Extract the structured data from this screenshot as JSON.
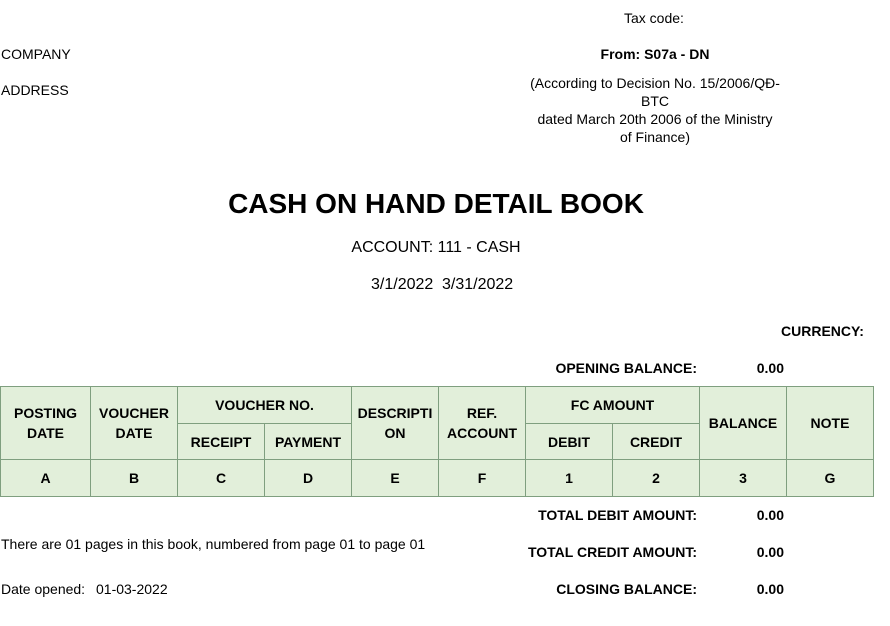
{
  "header": {
    "tax_code_label": "Tax code:",
    "company_label": "COMPANY",
    "address_label": "ADDRESS",
    "form_label": "From: S07a - DN",
    "decision_line1": "(According to Decision No. 15/2006/QĐ-",
    "decision_line2": "BTC",
    "decision_line3": "dated March 20th 2006 of the Ministry",
    "decision_line4": "of Finance)"
  },
  "title": {
    "main": "CASH ON HAND DETAIL BOOK",
    "account": "ACCOUNT: 111 - CASH",
    "date_from": "3/1/2022",
    "date_to": "3/31/2022"
  },
  "currency_label": "CURRENCY:",
  "opening": {
    "label": "OPENING BALANCE:",
    "value": "0.00"
  },
  "table": {
    "posting_date": "POSTING DATE",
    "voucher_date": "VOUCHER DATE",
    "voucher_no": "VOUCHER NO.",
    "receipt": "RECEIPT",
    "payment": "PAYMENT",
    "description": "DESCRIPTI ON",
    "ref_account": "REF. ACCOUNT",
    "fc_amount": "FC AMOUNT",
    "debit": "DEBIT",
    "credit": "CREDIT",
    "balance": "BALANCE",
    "note": "NOTE",
    "codes": [
      "A",
      "B",
      "C",
      "D",
      "E",
      "F",
      "1",
      "2",
      "3",
      "G"
    ]
  },
  "totals": {
    "total_debit_label": "TOTAL DEBIT AMOUNT:",
    "total_debit_value": "0.00",
    "total_credit_label": "TOTAL CREDIT AMOUNT:",
    "total_credit_value": "0.00",
    "closing_label": "CLOSING BALANCE:",
    "closing_value": "0.00"
  },
  "footer": {
    "pages_note": "There are 01 pages in this book, numbered from page 01 to page 01",
    "date_opened_label": "Date opened:",
    "date_opened_value": "01-03-2022"
  },
  "colors": {
    "header_fill": "#e2efda",
    "grid_border": "#7f9f7f"
  }
}
